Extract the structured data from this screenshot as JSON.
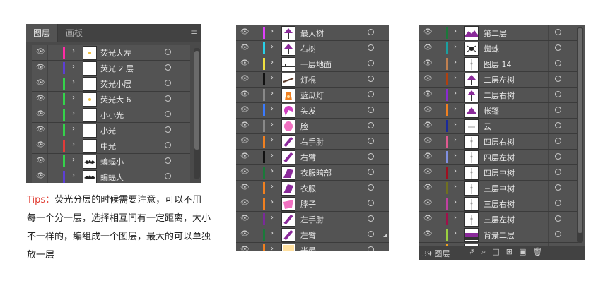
{
  "left_panel": {
    "tabs": [
      {
        "label": "图层",
        "active": true
      },
      {
        "label": "画板",
        "active": false
      }
    ],
    "menu_icon": "hamburger-icon",
    "rows": [
      {
        "label": "荧光大左",
        "color": "#ff2aa6",
        "thumb": "dot"
      },
      {
        "label": "荧光 2 层",
        "color": "#5d3fd3",
        "thumb": "blank"
      },
      {
        "label": "荧光小层",
        "color": "#35d24b",
        "thumb": "blank"
      },
      {
        "label": "荧光大 6",
        "color": "#35d24b",
        "thumb": "dot"
      },
      {
        "label": "小小光",
        "color": "#35d24b",
        "thumb": "blank"
      },
      {
        "label": "小光",
        "color": "#35d24b",
        "thumb": "blank"
      },
      {
        "label": "中光",
        "color": "#e23a3a",
        "thumb": "blank"
      },
      {
        "label": "蝙蝠小",
        "color": "#35d24b",
        "thumb": "bat"
      },
      {
        "label": "蝙蝠大",
        "color": "#5d3fd3",
        "thumb": "bat"
      }
    ]
  },
  "tips": {
    "label": "Tips：",
    "text": "荧光分层的时候需要注意，可以不用每一个分一层，选择相互间有一定距离，大小不一样的，编组成一个图层，最大的可以单独放一层"
  },
  "middle_panel": {
    "rows": [
      {
        "label": "最大树",
        "color": "#e040fb",
        "thumb": "tree"
      },
      {
        "label": "右树",
        "color": "#29d0e8",
        "thumb": "tree"
      },
      {
        "label": "一层地面",
        "color": "#f0e040",
        "thumb": "ground"
      },
      {
        "label": "灯棍",
        "color": "#111111",
        "thumb": "stick"
      },
      {
        "label": "蓝瓜灯",
        "color": "#888888",
        "thumb": "lamp"
      },
      {
        "label": "头发",
        "color": "#3a7bff",
        "thumb": "hair"
      },
      {
        "label": "脸",
        "color": "#888888",
        "thumb": "face"
      },
      {
        "label": "右手肘",
        "color": "#f08020",
        "thumb": "arm"
      },
      {
        "label": "右臂",
        "color": "#111111",
        "thumb": "arm"
      },
      {
        "label": "衣服暗部",
        "color": "#1a7a3a",
        "thumb": "cloth"
      },
      {
        "label": "衣服",
        "color": "#f08020",
        "thumb": "cloth"
      },
      {
        "label": "脖子",
        "color": "#f08020",
        "thumb": "neck"
      },
      {
        "label": "左手肘",
        "color": "#7a2a9a",
        "thumb": "arm"
      },
      {
        "label": "左臂",
        "color": "#1a7a3a",
        "thumb": "arm"
      },
      {
        "label": "光晕",
        "color": "#f08020",
        "thumb": "glow"
      }
    ]
  },
  "right_panel": {
    "rows": [
      {
        "label": "第二层",
        "color": "#1a7a3a",
        "thumb": "mount"
      },
      {
        "label": "蜘蛛",
        "color": "#1aa0a0",
        "thumb": "spider"
      },
      {
        "label": "图层 14",
        "color": "#c08050",
        "thumb": "pole"
      },
      {
        "label": "二层左树",
        "color": "#b04010",
        "thumb": "tree"
      },
      {
        "label": "二层右树",
        "color": "#8a2ad0",
        "thumb": "tree"
      },
      {
        "label": "帐篷",
        "color": "#f08020",
        "thumb": "tent"
      },
      {
        "label": "云",
        "color": "#1a2a9a",
        "thumb": "cloud"
      },
      {
        "label": "四层右树",
        "color": "#e05a90",
        "thumb": "pole"
      },
      {
        "label": "四层左树",
        "color": "#8090e0",
        "thumb": "pole"
      },
      {
        "label": "四层中树",
        "color": "#a01020",
        "thumb": "pole"
      },
      {
        "label": "三层中树",
        "color": "#707020",
        "thumb": "pole"
      },
      {
        "label": "三层右树",
        "color": "#c040a0",
        "thumb": "pole"
      },
      {
        "label": "三层左树",
        "color": "#a0104a",
        "thumb": "pole"
      },
      {
        "label": "背景二层",
        "color": "#9ad040",
        "thumb": "bg"
      },
      {
        "label": "背景一层",
        "color": "#f0a020",
        "thumb": "bg"
      }
    ],
    "footer": {
      "count": "39 图层",
      "icons": [
        "export-icon",
        "search-icon",
        "clip-icon",
        "new-sublayer-icon",
        "new-layer-icon",
        "trash-icon"
      ]
    }
  },
  "icons": {
    "eye": "eye-icon",
    "chevron": "chevron-right-icon",
    "target": "target-circle-icon"
  }
}
